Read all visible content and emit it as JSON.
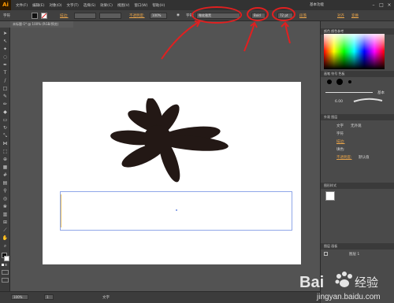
{
  "app": {
    "logo": "Ai",
    "menus": [
      "文件(F)",
      "编辑(E)",
      "对象(O)",
      "文字(T)",
      "选择(S)",
      "效果(C)",
      "视图(V)",
      "窗口(W)",
      "帮助(H)"
    ],
    "workspace": "基本功能"
  },
  "control_bar": {
    "tool_label": "字符",
    "stroke_label": "描边:",
    "opacity_label": "不透明度:",
    "opacity_value": "100%",
    "char_label": "字符:",
    "font_family": "微软雅黑",
    "font_style": "Bold",
    "font_size": "72 pt",
    "paragraph_label": "段落",
    "align_label": "对齐",
    "transform_label": "变换"
  },
  "document": {
    "tab_label": "未标题-1* @ 100% (RGB/预览)"
  },
  "panels": {
    "color_tab": "颜色  颜色参考",
    "brush_tab": "画笔  符号  色板",
    "brush_label": "基本",
    "stroke_size": "6.00",
    "layers_tab": "外观  图层",
    "appearance_rows": [
      {
        "label": "文字",
        "value": "无外观"
      },
      {
        "label": "字符",
        "value": ""
      },
      {
        "label": "描边:",
        "value": ""
      },
      {
        "label": "填色:",
        "value": ""
      },
      {
        "label": "不透明度:",
        "value": "默认值"
      }
    ],
    "graphic_styles_tab": "图形样式",
    "layers_bottom_tab": "图层  画板",
    "layer_name": "图层 1"
  },
  "status_bar": {
    "zoom": "100%",
    "page": "1",
    "tool_name": "文字"
  },
  "watermark": {
    "brand": "Bai",
    "brand_cn": "经验",
    "url": "jingyan.baidu.com"
  },
  "colors": {
    "annotation": "#e02020",
    "accent": "#e8a44a",
    "flower_fill": "#231815",
    "text_frame": "#8fa6e8"
  }
}
